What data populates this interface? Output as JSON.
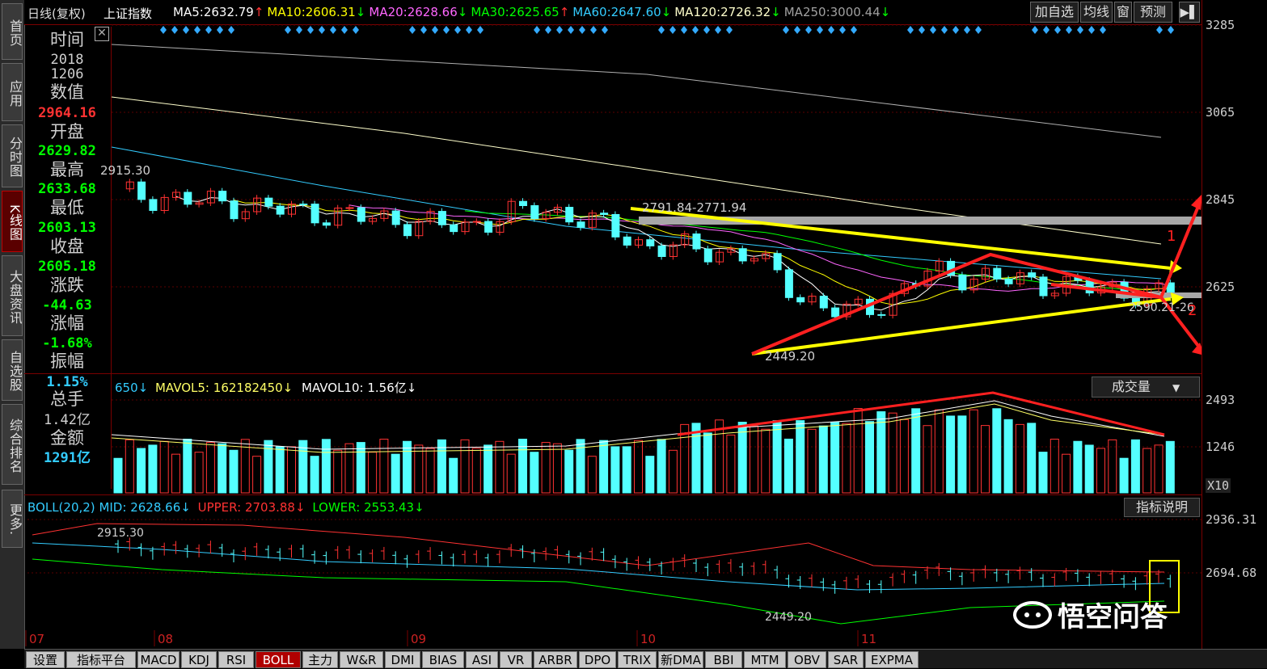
{
  "left_nav": [
    {
      "label": "首页",
      "active": false
    },
    {
      "label": "应用",
      "active": false
    },
    {
      "label": "分时图",
      "active": false
    },
    {
      "label": "K线图",
      "active": true
    },
    {
      "label": "大盘资讯",
      "active": false
    },
    {
      "label": "自选股",
      "active": false
    },
    {
      "label": "综合排名",
      "active": false
    },
    {
      "label": "更多.",
      "active": false
    }
  ],
  "top_bar": {
    "period": "日线(复权)",
    "index_name": "上证指数",
    "ma": [
      {
        "label": "MA5:",
        "value": "2632.79",
        "arrow": "↑",
        "color": "#ffffff"
      },
      {
        "label": "MA10:",
        "value": "2606.31",
        "arrow": "↓",
        "color": "#ffff00"
      },
      {
        "label": "MA20:",
        "value": "2628.66",
        "arrow": "↓",
        "color": "#ff66ff"
      },
      {
        "label": "MA30:",
        "value": "2625.65",
        "arrow": "↑",
        "color": "#00ff00"
      },
      {
        "label": "MA60:",
        "value": "2647.60",
        "arrow": "↓",
        "color": "#33ccff"
      },
      {
        "label": "MA120:",
        "value": "2726.32",
        "arrow": "↓",
        "color": "#ffffcc"
      },
      {
        "label": "MA250:",
        "value": "3000.44",
        "arrow": "↓",
        "color": "#a0a0a0"
      }
    ],
    "buttons": [
      "加自选",
      "均线",
      "窗",
      "预测"
    ],
    "exit_icon": "exit-arrow-icon"
  },
  "info_panel": {
    "time_label": "时间",
    "time_year": "2018",
    "time_date": "1206",
    "value_label": "数值",
    "value": "2964.16",
    "open_label": "开盘",
    "open": "2629.82",
    "high_label": "最高",
    "high": "2633.68",
    "low_label": "最低",
    "low": "2603.13",
    "close_label": "收盘",
    "close": "2605.18",
    "change_label": "涨跌",
    "change": "-44.63",
    "pct_label": "涨幅",
    "pct": "-1.68%",
    "amp_label": "振幅",
    "amp": "1.15%",
    "vol_label": "总手",
    "vol": "1.42亿",
    "amount_label": "金额",
    "amount": "1291亿"
  },
  "price_axis": {
    "labels": [
      "3285",
      "3065",
      "2845",
      "2625"
    ]
  },
  "price_annotations": {
    "high_left": "2915.30",
    "peak": "2791.84-2771.94",
    "low": "2449.20",
    "right_mid": "2590.21-26",
    "arrow1": "1",
    "arrow2": "2"
  },
  "vol_header": {
    "vol_value": "650↓",
    "mavol5_label": "MAVOL5:",
    "mavol5": "162182450↓",
    "mavol10_label": "MAVOL10:",
    "mavol10": "1.56亿↓",
    "dropdown": "成交量"
  },
  "vol_axis": {
    "labels": [
      "2493",
      "1246",
      "X10"
    ]
  },
  "boll_header": {
    "name": "BOLL(20,2)",
    "mid_label": "MID:",
    "mid": "2628.66↓",
    "upper_label": "UPPER:",
    "upper": "2703.88↓",
    "lower_label": "LOWER:",
    "lower": "2553.43↓",
    "explain_button": "指标说明"
  },
  "boll_axis": {
    "labels": [
      "2936.31",
      "2694.68"
    ]
  },
  "boll_annotations": {
    "high": "2915.30",
    "low": "2449.20"
  },
  "month_labels": [
    "07",
    "08",
    "09",
    "10",
    "11"
  ],
  "bottom_tabs": [
    {
      "label": "设置",
      "active": false
    },
    {
      "label": "指标平台",
      "active": false
    },
    {
      "label": "MACD",
      "active": false
    },
    {
      "label": "KDJ",
      "active": false
    },
    {
      "label": "RSI",
      "active": false
    },
    {
      "label": "BOLL",
      "active": true
    },
    {
      "label": "主力",
      "active": false
    },
    {
      "label": "W&R",
      "active": false
    },
    {
      "label": "DMI",
      "active": false
    },
    {
      "label": "BIAS",
      "active": false
    },
    {
      "label": "ASI",
      "active": false
    },
    {
      "label": "VR",
      "active": false
    },
    {
      "label": "ARBR",
      "active": false
    },
    {
      "label": "DPO",
      "active": false
    },
    {
      "label": "TRIX",
      "active": false
    },
    {
      "label": "新DMA",
      "active": false
    },
    {
      "label": "BBI",
      "active": false
    },
    {
      "label": "MTM",
      "active": false
    },
    {
      "label": "OBV",
      "active": false
    },
    {
      "label": "SAR",
      "active": false
    },
    {
      "label": "EXPMA",
      "active": false
    }
  ],
  "watermark": "悟空问答",
  "colors": {
    "up": "#ff3232",
    "down": "#54ffff",
    "frame": "#7a0000",
    "trend_yellow": "#ffff00",
    "trend_red": "#ff2020"
  }
}
